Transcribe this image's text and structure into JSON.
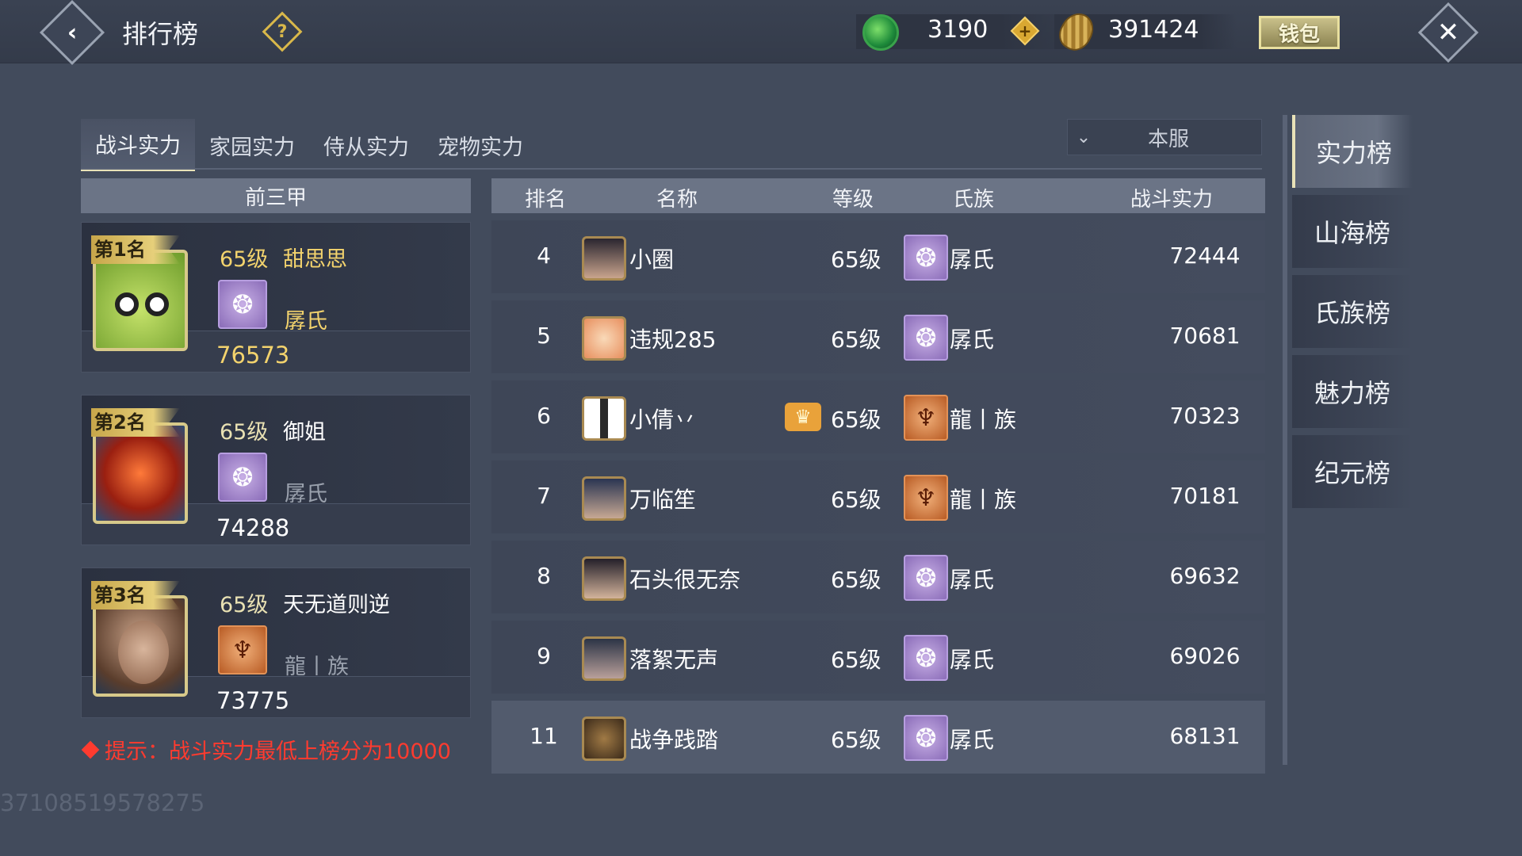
{
  "header": {
    "title": "排行榜",
    "jade_amount": "3190",
    "coin_amount": "391424",
    "wallet_label": "钱包"
  },
  "tabs": [
    "战斗实力",
    "家园实力",
    "侍从实力",
    "宠物实力"
  ],
  "server_filter": "本服",
  "top3": {
    "header": "前三甲",
    "entries": [
      {
        "rank_label": "第1名",
        "level": "65级",
        "name": "甜思思",
        "clan": "孱氏",
        "power": "76573"
      },
      {
        "rank_label": "第2名",
        "level": "65级",
        "name": "御姐",
        "clan": "孱氏",
        "power": "74288"
      },
      {
        "rank_label": "第3名",
        "level": "65级",
        "name": "天无道则逆",
        "clan": "龍丨族",
        "power": "73775"
      }
    ]
  },
  "table": {
    "columns": [
      "排名",
      "名称",
      "等级",
      "氏族",
      "战斗实力"
    ],
    "rows": [
      {
        "rank": "4",
        "name": "小圈",
        "level": "65级",
        "clan": "孱氏",
        "power": "72444"
      },
      {
        "rank": "5",
        "name": "违规285",
        "level": "65级",
        "clan": "孱氏",
        "power": "70681"
      },
      {
        "rank": "6",
        "name": "小倩丷",
        "level": "65级",
        "clan": "龍丨族",
        "power": "70323"
      },
      {
        "rank": "7",
        "name": "万临笙",
        "level": "65级",
        "clan": "龍丨族",
        "power": "70181"
      },
      {
        "rank": "8",
        "name": "石头很无奈",
        "level": "65级",
        "clan": "孱氏",
        "power": "69632"
      },
      {
        "rank": "9",
        "name": "落絮无声",
        "level": "65级",
        "clan": "孱氏",
        "power": "69026"
      },
      {
        "rank": "11",
        "name": "战争践踏",
        "level": "65级",
        "clan": "孱氏",
        "power": "68131"
      }
    ]
  },
  "tip": "提示：战斗实力最低上榜分为10000",
  "uid": "37108519578275",
  "side_menu": [
    "实力榜",
    "山海榜",
    "氏族榜",
    "魅力榜",
    "纪元榜"
  ],
  "icons": {
    "jade": "jade-coin-icon",
    "coin": "shell-coin-icon",
    "crown": "crown-icon"
  },
  "colors": {
    "background": "#424b5c",
    "gold_text": "#f3d36d",
    "tip_red": "#ff3b2f",
    "header_bar": "#6b7486"
  }
}
